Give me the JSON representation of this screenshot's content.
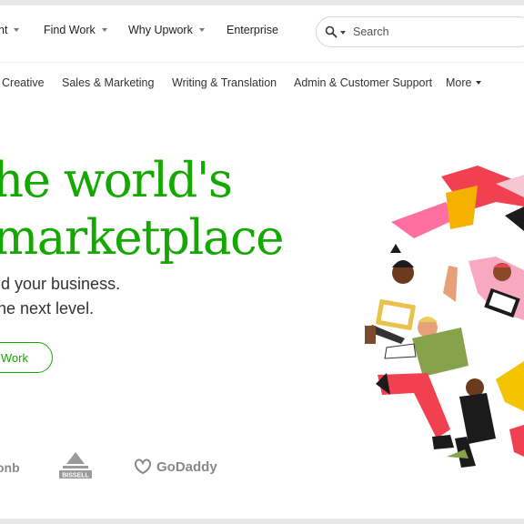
{
  "nav": {
    "items": [
      {
        "label": "nt",
        "has_caret": true
      },
      {
        "label": "Find Work",
        "has_caret": true
      },
      {
        "label": "Why Upwork",
        "has_caret": true
      },
      {
        "label": "Enterprise",
        "has_caret": false
      }
    ],
    "search": {
      "placeholder": "Search"
    }
  },
  "categories": {
    "items": [
      "Creative",
      "Sales & Marketing",
      "Writing & Translation",
      "Admin & Customer Support"
    ],
    "more_label": "More"
  },
  "hero": {
    "headline_line1": "he world's",
    "headline_line2": "marketplace",
    "sub_line1": "ld your business.",
    "sub_line2": "he next level.",
    "cta_label": "Work"
  },
  "logos": {
    "airbnb": "onb",
    "bissell": "BISSELL",
    "godaddy": "GoDaddy"
  },
  "colors": {
    "brand_green": "#14a800",
    "text": "#222222"
  }
}
